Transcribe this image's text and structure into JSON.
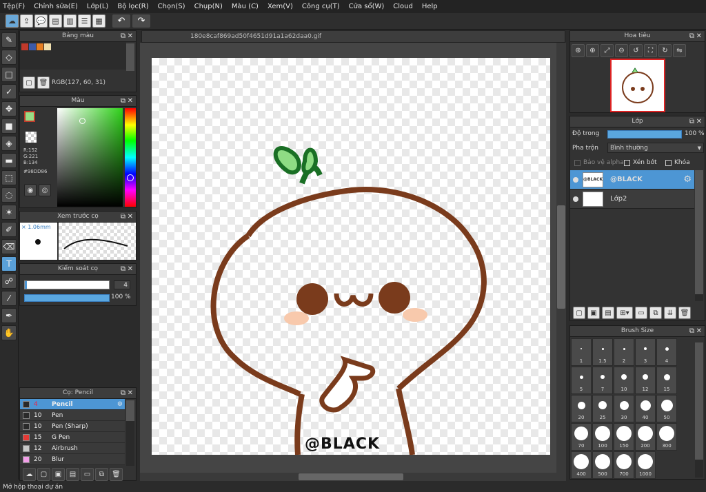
{
  "menu": [
    "Tệp(F)",
    "Chỉnh sửa(E)",
    "Lớp(L)",
    "Bộ lọc(R)",
    "Chọn(S)",
    "Chụp(N)",
    "Màu (C)",
    "Xem(V)",
    "Công cụ(T)",
    "Cửa sổ(W)",
    "Cloud",
    "Help"
  ],
  "canvas": {
    "tab_title": "180e8caf869ad50f4651d91a1a62daa0.gif",
    "watermark": "@BLACK"
  },
  "palette_panel": {
    "title": "Bảng màu",
    "rgb_readout": "RGB(127, 60, 31)",
    "swatches": [
      "#c0392b",
      "#3d5aa8",
      "#e67e22",
      "#f0e0b0"
    ]
  },
  "color_panel": {
    "title": "Màu",
    "r": "R:152",
    "g": "G:221",
    "b": "B:134",
    "hex": "#98DD86",
    "fg": "#98dd86"
  },
  "preview_panel": {
    "title": "Xem trước cọ",
    "size": "1.06mm"
  },
  "brush_control": {
    "title": "Kiểm soát cọ",
    "size_value": "4",
    "opacity_value": "100 %"
  },
  "brush_list": {
    "title": "Cọ: Pencil",
    "items": [
      {
        "size": "4",
        "name": "Pencil",
        "color": "#2a2a2a"
      },
      {
        "size": "10",
        "name": "Pen",
        "color": "#2a2a2a"
      },
      {
        "size": "10",
        "name": "Pen (Sharp)",
        "color": "#2a2a2a"
      },
      {
        "size": "15",
        "name": "G Pen",
        "color": "#e53935"
      },
      {
        "size": "12",
        "name": "Airbrush",
        "color": "#c8c8c8"
      },
      {
        "size": "20",
        "name": "Blur",
        "color": "#f29ee8"
      }
    ]
  },
  "navigator": {
    "title": "Hoa tiêu"
  },
  "layers": {
    "title": "Lớp",
    "opacity_label": "Độ trong",
    "opacity_value": "100 %",
    "blend_label": "Pha trộn",
    "blend_value": "Bình thường",
    "protect_alpha": "Bảo vệ alpha",
    "clipping": "Xén bớt",
    "lock": "Khóa",
    "items": [
      {
        "name": "@BLACK",
        "thumb_text": "@BLACK"
      },
      {
        "name": "Lớp2"
      }
    ]
  },
  "brush_size": {
    "title": "Brush Size",
    "sizes": [
      "1",
      "1.5",
      "2",
      "3",
      "4",
      "5",
      "7",
      "10",
      "12",
      "15",
      "20",
      "25",
      "30",
      "40",
      "50",
      "70",
      "100",
      "150",
      "200",
      "300",
      "400",
      "500",
      "700",
      "1000"
    ]
  },
  "status": "Mở hộp thoại dự án"
}
